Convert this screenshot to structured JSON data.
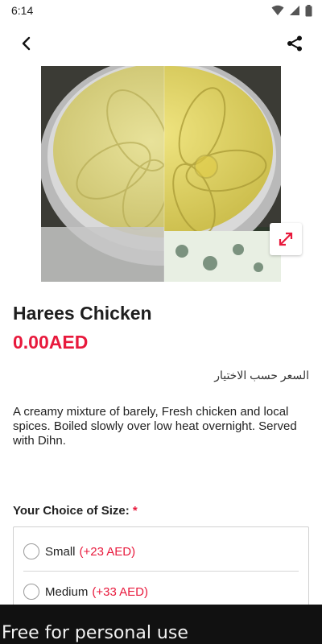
{
  "status_bar": {
    "time": "6:14",
    "icons": [
      "wifi-icon",
      "signal-icon",
      "battery-icon"
    ]
  },
  "app_bar": {
    "back_icon": "chevron-left-icon",
    "share_icon": "share-icon"
  },
  "product": {
    "image_alt": "Harees Chicken dish",
    "expand_icon": "expand-icon",
    "name": "Harees Chicken",
    "price": "0.00AED",
    "arabic_note": "السعر حسب الاختيار",
    "description": "A creamy mixture of barely, Fresh chicken and local spices. Boiled slowly over low heat overnight. Served with Dihn."
  },
  "size_choice": {
    "heading": "Your Choice of Size:",
    "required_mark": "*",
    "options": [
      {
        "label": "Small",
        "price": "(+23 AED)"
      },
      {
        "label": "Medium",
        "price": "(+33 AED)"
      }
    ]
  },
  "watermark": {
    "text": "Free for personal use"
  },
  "colors": {
    "accent": "#e8193c",
    "text": "#222222",
    "watermark_bg": "#111111"
  }
}
